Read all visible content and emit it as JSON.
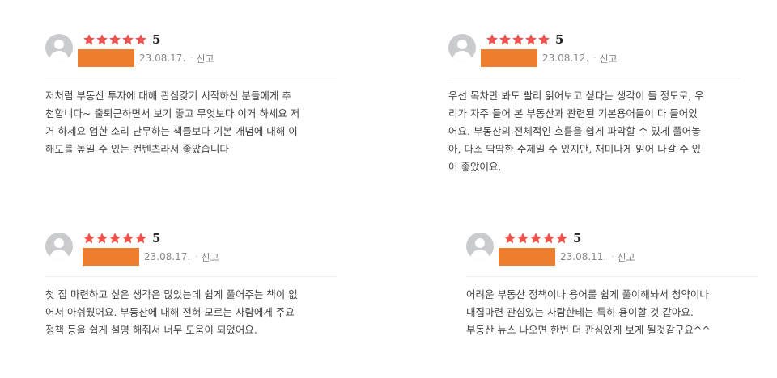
{
  "colors": {
    "star": "#ef5350",
    "name_redaction": "#ee7d2e",
    "avatar_bg": "#c9cbcf"
  },
  "reviews": [
    {
      "score": "5",
      "stars": 5,
      "date": "23.08.17.",
      "separator": "·",
      "report": "신고",
      "text": "저처럼 부동산 투자에 대해 관심갖기 시작하신 분들에게 추\n천합니다~ 출퇴근하면서 보기 좋고 무엇보다 이거 하세요 저\n거 하세요 엄한 소리 난무하는 책들보다 기본 개념에 대해 이\n해도를 높일 수 있는 컨텐츠라서 좋았습니다"
    },
    {
      "score": "5",
      "stars": 5,
      "date": "23.08.12.",
      "separator": "·",
      "report": "신고",
      "text": "우선 목차만 봐도 빨리 읽어보고 싶다는 생각이 들 정도로, 우\n리가 자주 들어 본 부동산과 관련된 기본용어들이 다 들어있\n어요. 부동산의 전체적인 흐름을 쉽게 파악할 수 있게 풀어놓\n아, 다소 딱딱한 주제일 수 있지만, 재미나게 읽어 나갈 수 있\n어 좋았어요."
    },
    {
      "score": "5",
      "stars": 5,
      "date": "23.08.17.",
      "separator": "·",
      "report": "신고",
      "text": "첫 집 마련하고 싶은 생각은 많았는데 쉽게 풀어주는 책이 없\n어서 아쉬웠어요. 부동산에 대해 전혀 모르는 사람에게 주요\n정책 등을 쉽게 설명 해줘서 너무 도움이 되었어요."
    },
    {
      "score": "5",
      "stars": 5,
      "date": "23.08.11.",
      "separator": "·",
      "report": "신고",
      "text": "어려운 부동산 정책이나 용어를 쉽게 풀이해놔서 청약이나\n내집마련 관심있는 사람한테는 특히 용이할 것 같아요.\n부동산 뉴스 나오면 한번 더 관심있게 보게 될것같구요^^"
    }
  ]
}
